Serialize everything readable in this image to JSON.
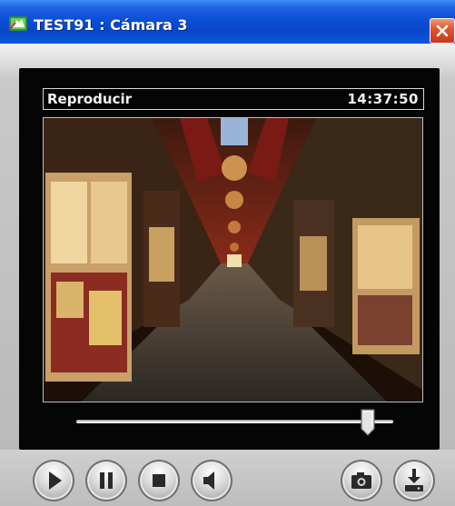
{
  "window": {
    "title": "TEST91 : Cámara 3"
  },
  "player": {
    "status": "Reproducir",
    "time": "14:37:50"
  },
  "playback": {
    "position_fraction": 0.92
  },
  "icons": {
    "app": "camera-app-icon",
    "close": "close-icon",
    "play": "play-icon",
    "pause": "pause-icon",
    "stop": "stop-icon",
    "audio": "speaker-icon",
    "snapshot": "camera-icon",
    "save": "download-icon"
  },
  "colors": {
    "titlebar": "#0a4fd6",
    "close": "#e2552f",
    "player_bg": "#050505"
  }
}
